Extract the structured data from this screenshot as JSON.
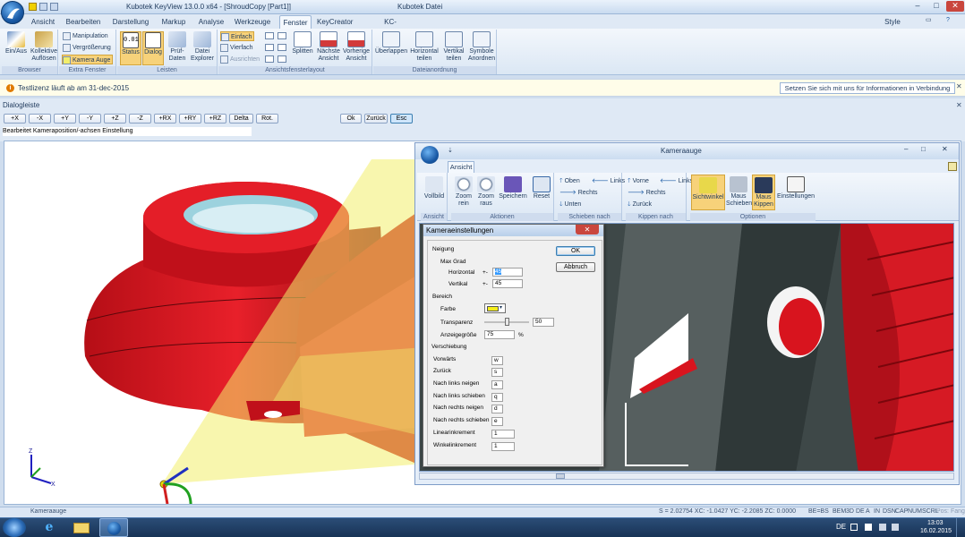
{
  "titlebar": {
    "title": "Kubotek KeyView 13.0.0 x64 - [ShroudCopy [Part1]]",
    "file_menu": "Kubotek Datei"
  },
  "menu": {
    "tabs": [
      "Ansicht",
      "Bearbeiten",
      "Darstellung",
      "Markup",
      "Analyse",
      "Werkzeuge",
      "Fenster",
      "KeyCreator",
      "KC-Einstellungen"
    ],
    "active": "Fenster",
    "style_label": "Style"
  },
  "ribbon": {
    "groups": [
      {
        "label": "Browser",
        "buttons": [
          "Ein/Aus",
          "Kollektive Auflösen"
        ]
      },
      {
        "label": "Extra Fenster",
        "buttons": [
          "Manipulation",
          "Vergrößerung",
          "Kamera Auge"
        ]
      },
      {
        "label": "Leisten",
        "buttons": [
          "Status",
          "Dialog",
          "Prüf-Daten",
          "Datei Explorer"
        ]
      },
      {
        "label": "Ansichtsfensterlayout",
        "buttons": [
          "Einfach",
          "Vierfach",
          "Ausrichten",
          "Splitten",
          "Nächste Ansicht",
          "Vorherige Ansicht"
        ]
      },
      {
        "label": "Dateianordnung",
        "buttons": [
          "Überlappen",
          "Horizontal teilen",
          "Vertikal teilen",
          "Symbole Anordnen"
        ]
      }
    ]
  },
  "info": {
    "message": "Testlizenz läuft ab am 31-dec-2015",
    "contact": "Setzen Sie sich mit uns für Informationen in Verbindung"
  },
  "dialogleiste": {
    "title": "Dialogleiste",
    "axis_buttons": [
      "+X",
      "-X",
      "+Y",
      "-Y",
      "+Z",
      "-Z",
      "+RX",
      "+RY",
      "+RZ",
      "Delta",
      "Rot."
    ],
    "ok": "Ok",
    "back": "Zurück",
    "esc": "Esc",
    "status": "Bearbeitet Kameraposition/-achsen Einstellung"
  },
  "kamerauge": {
    "title": "Kameraauge",
    "tab": "Ansicht",
    "groups": [
      {
        "label": "Ansicht",
        "buttons": [
          "Vollbild"
        ]
      },
      {
        "label": "Aktionen",
        "buttons": [
          "Zoom rein",
          "Zoom raus",
          "Speichern",
          "Reset"
        ]
      },
      {
        "label": "Schieben nach",
        "buttons": [
          "Oben",
          "Links",
          "Rechts",
          "Unten"
        ]
      },
      {
        "label": "Kippen nach",
        "buttons": [
          "Vorne",
          "Links",
          "Rechts",
          "Zurück"
        ]
      },
      {
        "label": "Optionen",
        "buttons": [
          "Sichtwinkel",
          "Maus Schieben",
          "Maus Kippen",
          "Einstellungen"
        ]
      }
    ]
  },
  "settings": {
    "title": "Kameraeinstellungen",
    "ok": "OK",
    "cancel": "Abbruch",
    "neigung": "Neigung",
    "max_grad": "Max Grad",
    "horizontal_label": "Horizontal",
    "horizontal_pm": "+-",
    "horizontal_value": "45",
    "vertikal_label": "Vertikal",
    "vertikal_pm": "+-",
    "vertikal_value": "45",
    "bereich": "Bereich",
    "farbe": "Farbe",
    "farbe_color": "#f5ee1a",
    "transparenz": "Transparenz",
    "transparenz_value": "50",
    "transparenz_fraction": 0.5,
    "anzeige": "Anzeigegröße",
    "anzeige_value": "75",
    "percent": "%",
    "verschiebung": "Verschiebung",
    "keys": [
      {
        "label": "Vorwärts",
        "value": "w"
      },
      {
        "label": "Zurück",
        "value": "s"
      },
      {
        "label": "Nach links neigen",
        "value": "a"
      },
      {
        "label": "Nach links schieben",
        "value": "q"
      },
      {
        "label": "Nach rechts neigen",
        "value": "d"
      },
      {
        "label": "Nach rechts schieben",
        "value": "e"
      }
    ],
    "linear_label": "Linearinkrement",
    "linear_value": "1",
    "winkel_label": "Winkelinkrement",
    "winkel_value": "1"
  },
  "status": {
    "left": "Kameraauge",
    "coords": "S = 2.02754  XC: -1.0427   YC: -2.2085   ZC: 0.0000",
    "flags": [
      "BE=BS",
      "BEM",
      "3D",
      "DE",
      "A",
      "IN",
      "DSN",
      "CAP",
      "NUM",
      "SCRL"
    ],
    "pos": "Pos: Fang"
  },
  "taskbar": {
    "lang": "DE",
    "time": "13:03",
    "date": "16.02.2015"
  },
  "colors": {
    "part_red": "#d8141e",
    "cone_yellow": "#f2ee6b",
    "accent": "#1a5aa6"
  }
}
